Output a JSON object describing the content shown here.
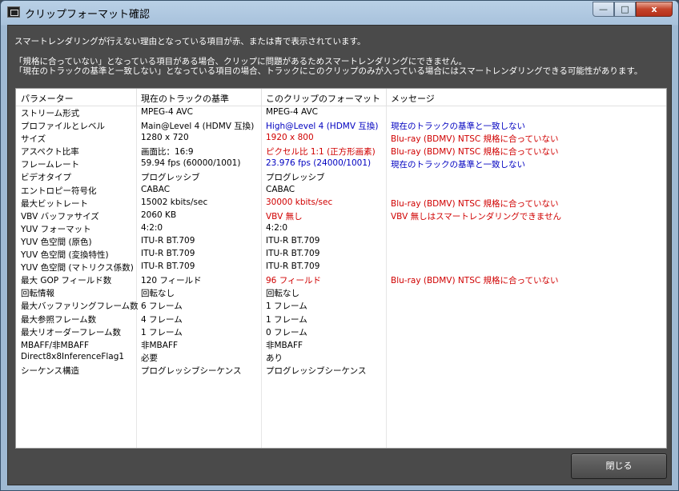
{
  "window": {
    "title": "クリップフォーマット確認",
    "close_glyph": "x",
    "min_glyph": "—",
    "max_glyph": "□"
  },
  "info_lines": [
    "スマートレンダリングが行えない理由となっている項目が赤、または青で表示されています。",
    "「規格に合っていない」となっている項目がある場合、クリップに問題があるためスマートレンダリングにできません。",
    "「現在のトラックの基準と一致しない」となっている項目の場合、トラックにこのクリップのみが入っている場合にはスマートレンダリングできる可能性があります。"
  ],
  "table": {
    "headers": [
      "パラメーター",
      "現在のトラックの基準",
      "このクリップのフォーマット",
      "メッセージ"
    ],
    "rows": [
      {
        "param": "ストリーム形式",
        "current": "MPEG-4 AVC",
        "clip": "MPEG-4 AVC",
        "message": "",
        "color": "normal"
      },
      {
        "param": "プロファイルとレベル",
        "current": "Main@Level 4 (HDMV 互換)",
        "clip": "High@Level 4 (HDMV 互換)",
        "message": "現在のトラックの基準と一致しない",
        "color": "blue"
      },
      {
        "param": "サイズ",
        "current": "1280 x 720",
        "clip": "1920 x 800",
        "message": "Blu-ray (BDMV) NTSC 規格に合っていない",
        "color": "red"
      },
      {
        "param": "アスペクト比率",
        "current": "画面比：16:9",
        "clip": "ピクセル比 1:1 (正方形画素)",
        "message": "Blu-ray (BDMV) NTSC 規格に合っていない",
        "color": "red"
      },
      {
        "param": "フレームレート",
        "current": "59.94 fps (60000/1001)",
        "clip": "23.976 fps (24000/1001)",
        "message": "現在のトラックの基準と一致しない",
        "color": "blue"
      },
      {
        "param": "ビデオタイプ",
        "current": "プログレッシブ",
        "clip": "プログレッシブ",
        "message": "",
        "color": "normal"
      },
      {
        "param": "エントロピー符号化",
        "current": "CABAC",
        "clip": "CABAC",
        "message": "",
        "color": "normal"
      },
      {
        "param": "最大ビットレート",
        "current": "15002 kbits/sec",
        "clip": "30000 kbits/sec",
        "message": "Blu-ray (BDMV) NTSC 規格に合っていない",
        "color": "red"
      },
      {
        "param": "VBV バッファサイズ",
        "current": "2060 KB",
        "clip": "VBV 無し",
        "message": "VBV 無しはスマートレンダリングできません",
        "color": "red"
      },
      {
        "param": "YUV フォーマット",
        "current": "4:2:0",
        "clip": "4:2:0",
        "message": "",
        "color": "normal"
      },
      {
        "param": "YUV 色空間 (原色)",
        "current": "ITU-R BT.709",
        "clip": "ITU-R BT.709",
        "message": "",
        "color": "normal"
      },
      {
        "param": "YUV 色空間 (変換特性)",
        "current": "ITU-R BT.709",
        "clip": "ITU-R BT.709",
        "message": "",
        "color": "normal"
      },
      {
        "param": "YUV 色空間 (マトリクス係数)",
        "current": "ITU-R BT.709",
        "clip": "ITU-R BT.709",
        "message": "",
        "color": "normal"
      },
      {
        "param": "最大 GOP フィールド数",
        "current": "120 フィールド",
        "clip": "96 フィールド",
        "message": "Blu-ray (BDMV) NTSC 規格に合っていない",
        "color": "red"
      },
      {
        "param": "回転情報",
        "current": "回転なし",
        "clip": "回転なし",
        "message": "",
        "color": "normal"
      },
      {
        "param": "最大バッファリングフレーム数",
        "current": "6 フレーム",
        "clip": "1 フレーム",
        "message": "",
        "color": "normal"
      },
      {
        "param": "最大参照フレーム数",
        "current": "4 フレーム",
        "clip": "1 フレーム",
        "message": "",
        "color": "normal"
      },
      {
        "param": "最大リオーダーフレーム数",
        "current": "1 フレーム",
        "clip": "0 フレーム",
        "message": "",
        "color": "normal"
      },
      {
        "param": "MBAFF/非MBAFF",
        "current": "非MBAFF",
        "clip": "非MBAFF",
        "message": "",
        "color": "normal"
      },
      {
        "param": "Direct8x8InferenceFlag1",
        "current": "必要",
        "clip": "あり",
        "message": "",
        "color": "normal"
      },
      {
        "param": "シーケンス構造",
        "current": "プログレッシブシーケンス",
        "clip": "プログレッシブシーケンス",
        "message": "",
        "color": "normal"
      }
    ]
  },
  "close_button_label": "閉じる"
}
